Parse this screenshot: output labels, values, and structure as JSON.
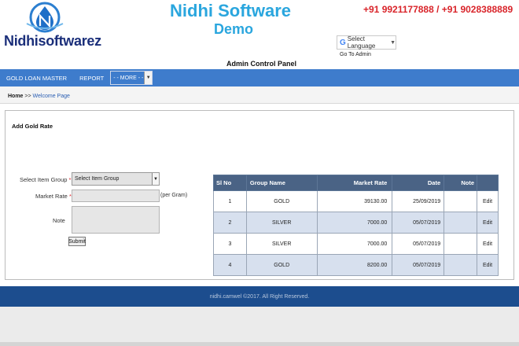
{
  "header": {
    "brand_name": "Nidhisoftwarez",
    "title": "Nidhi Software",
    "subtitle": "Demo",
    "phones": "+91 9921177888 / +91 9028388889",
    "language_label": "Select Language",
    "goto_admin": "Go To Admin",
    "admin_panel": "Admin Control Panel"
  },
  "nav": {
    "items": [
      "GOLD LOAN MASTER",
      "REPORT"
    ],
    "more_select": "- - MORE - -"
  },
  "breadcrumb": {
    "home": "Home",
    "separator": ">>",
    "current": "Welcome Page"
  },
  "form": {
    "title": "Add Gold Rate",
    "item_group_label": "Select Item Group",
    "item_group_value": "Select Item Group",
    "market_rate_label": "Market Rate",
    "market_rate_value": "",
    "per_gram": "(per Gram)",
    "note_label": "Note",
    "note_value": "",
    "required_mark": "*",
    "submit_label": "Submit"
  },
  "table": {
    "headers": [
      "Sl No",
      "Group Name",
      "Market Rate",
      "Date",
      "Note"
    ],
    "edit_label": "Edit",
    "rows": [
      {
        "sl": "1",
        "group": "GOLD",
        "rate": "39130.00",
        "date": "25/09/2019",
        "note": ""
      },
      {
        "sl": "2",
        "group": "SILVER",
        "rate": "7000.00",
        "date": "05/07/2019",
        "note": ""
      },
      {
        "sl": "3",
        "group": "SILVER",
        "rate": "7000.00",
        "date": "05/07/2019",
        "note": ""
      },
      {
        "sl": "4",
        "group": "GOLD",
        "rate": "8200.00",
        "date": "05/07/2019",
        "note": ""
      }
    ]
  },
  "footer": {
    "copyright": "nidhi.camwel ©2017. All Right Reserved."
  },
  "colors": {
    "nav": "#3e7ccc",
    "title": "#2aa6de",
    "phones": "#d9242a",
    "table_header": "#4a6385",
    "footer": "#1c4d8e"
  }
}
